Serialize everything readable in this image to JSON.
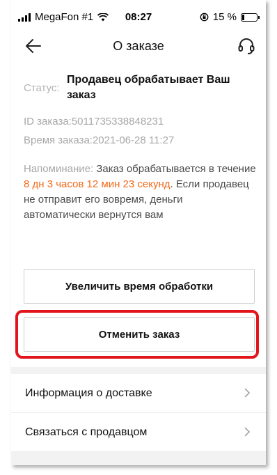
{
  "status_bar": {
    "carrier": "MegaFon #1",
    "time": "08:27",
    "battery_percent": "15 %",
    "battery_level": 0.15
  },
  "nav": {
    "title": "О заказе",
    "back_icon": "arrow-left-icon",
    "support_icon": "headset-icon"
  },
  "order": {
    "status_label": "Статус:",
    "status_value": "Продавец обрабатывает Ваш заказ",
    "id_label": "ID заказа:",
    "id_value": "5011735338848231",
    "time_label": "Время заказа:",
    "time_value": "2021-06-28 11:27"
  },
  "reminder": {
    "label": "Напоминание:",
    "text_before": " Заказ обрабатывается в течение ",
    "countdown": "8 дн 3 часов 12 мин 23 секунд",
    "text_after": ". Если продавец не отправит его вовремя, деньги автоматически вернутся вам",
    "accent_color": "#f26a1b"
  },
  "buttons": {
    "extend": "Увеличить время обработки",
    "cancel": "Отменить заказ",
    "highlight_color": "#e1151b"
  },
  "links": [
    {
      "label": "Информация о доставке"
    },
    {
      "label": "Связаться с продавцом"
    }
  ]
}
